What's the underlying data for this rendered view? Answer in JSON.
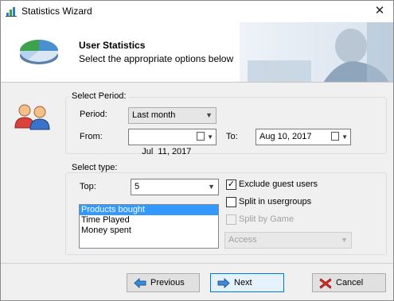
{
  "window": {
    "title": "Statistics Wizard",
    "close_glyph": "✕"
  },
  "header": {
    "title": "User Statistics",
    "subtitle": "Select the appropriate options below"
  },
  "period": {
    "group_label": "Select Period:",
    "period_label": "Period:",
    "period_value": "Last month",
    "from_label": "From:",
    "from_value": "Jul  11, 2017",
    "to_label": "To:",
    "to_value": "Aug 10, 2017"
  },
  "type": {
    "group_label": "Select type:",
    "top_label": "Top:",
    "top_value": "5",
    "list_items": [
      "Products bought",
      "Time Played",
      "Money spent"
    ],
    "exclude_guests_label": "Exclude guest users",
    "exclude_guests_checked": true,
    "split_usergroups_label": "Split in usergroups",
    "split_usergroups_checked": false,
    "split_game_label": "Split by Game",
    "split_game_enabled": false,
    "access_value": "Access"
  },
  "buttons": {
    "previous": "Previous",
    "next": "Next",
    "cancel": "Cancel"
  },
  "icons": {
    "app": "chart-icon",
    "logo": "pie-chart-icon",
    "users": "users-icon",
    "previous": "arrow-left-icon",
    "next": "arrow-right-icon",
    "cancel": "red-x-icon",
    "calendar": "calendar-icon",
    "dropdown": "chevron-down-icon"
  },
  "colors": {
    "selection": "#3399ff",
    "focus_border": "#0078d7",
    "cancel_red": "#d93025"
  }
}
